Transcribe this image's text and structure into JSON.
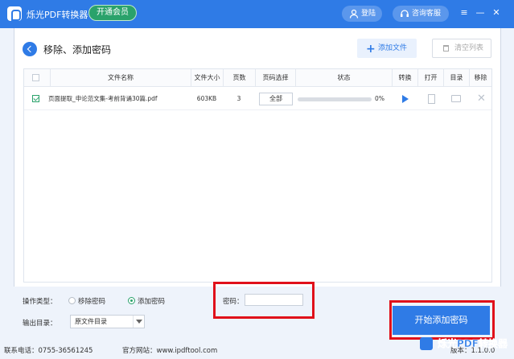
{
  "app": {
    "title": "烁光PDF转换器",
    "vip_label": "开通会员"
  },
  "header": {
    "login_label": "登陆",
    "support_label": "咨询客服"
  },
  "page": {
    "title": "移除、添加密码"
  },
  "toolbar": {
    "add_file_label": "添加文件",
    "clear_list_label": "清空列表"
  },
  "table": {
    "headers": [
      "文件名称",
      "文件大小",
      "页数",
      "页码选择",
      "状态",
      "转换",
      "打开",
      "目录",
      "移除"
    ],
    "rows": [
      {
        "checked": true,
        "name": "页面提取_申论范文集-考前背诵30篇.pdf",
        "size": "603KB",
        "pages": "3",
        "page_select": "全部",
        "progress": 0,
        "progress_text": "0%"
      }
    ]
  },
  "options": {
    "op_type_label": "操作类型：",
    "remove_label": "移除密码",
    "add_label": "添加密码",
    "selected": "add",
    "output_label": "输出目录：",
    "output_value": "原文件目录",
    "password_label": "密码：",
    "password_value": ""
  },
  "actions": {
    "start_label": "开始添加密码"
  },
  "footer": {
    "phone": "联系电话：0755-36561245",
    "website": "官方网站：www.ipdftool.com",
    "version": "版本：1.1.0.0",
    "watermark": "烁光PDF转换器"
  },
  "colors": {
    "primary": "#2f7be6",
    "vip": "#2aa26b",
    "highlight": "#e0101a"
  }
}
